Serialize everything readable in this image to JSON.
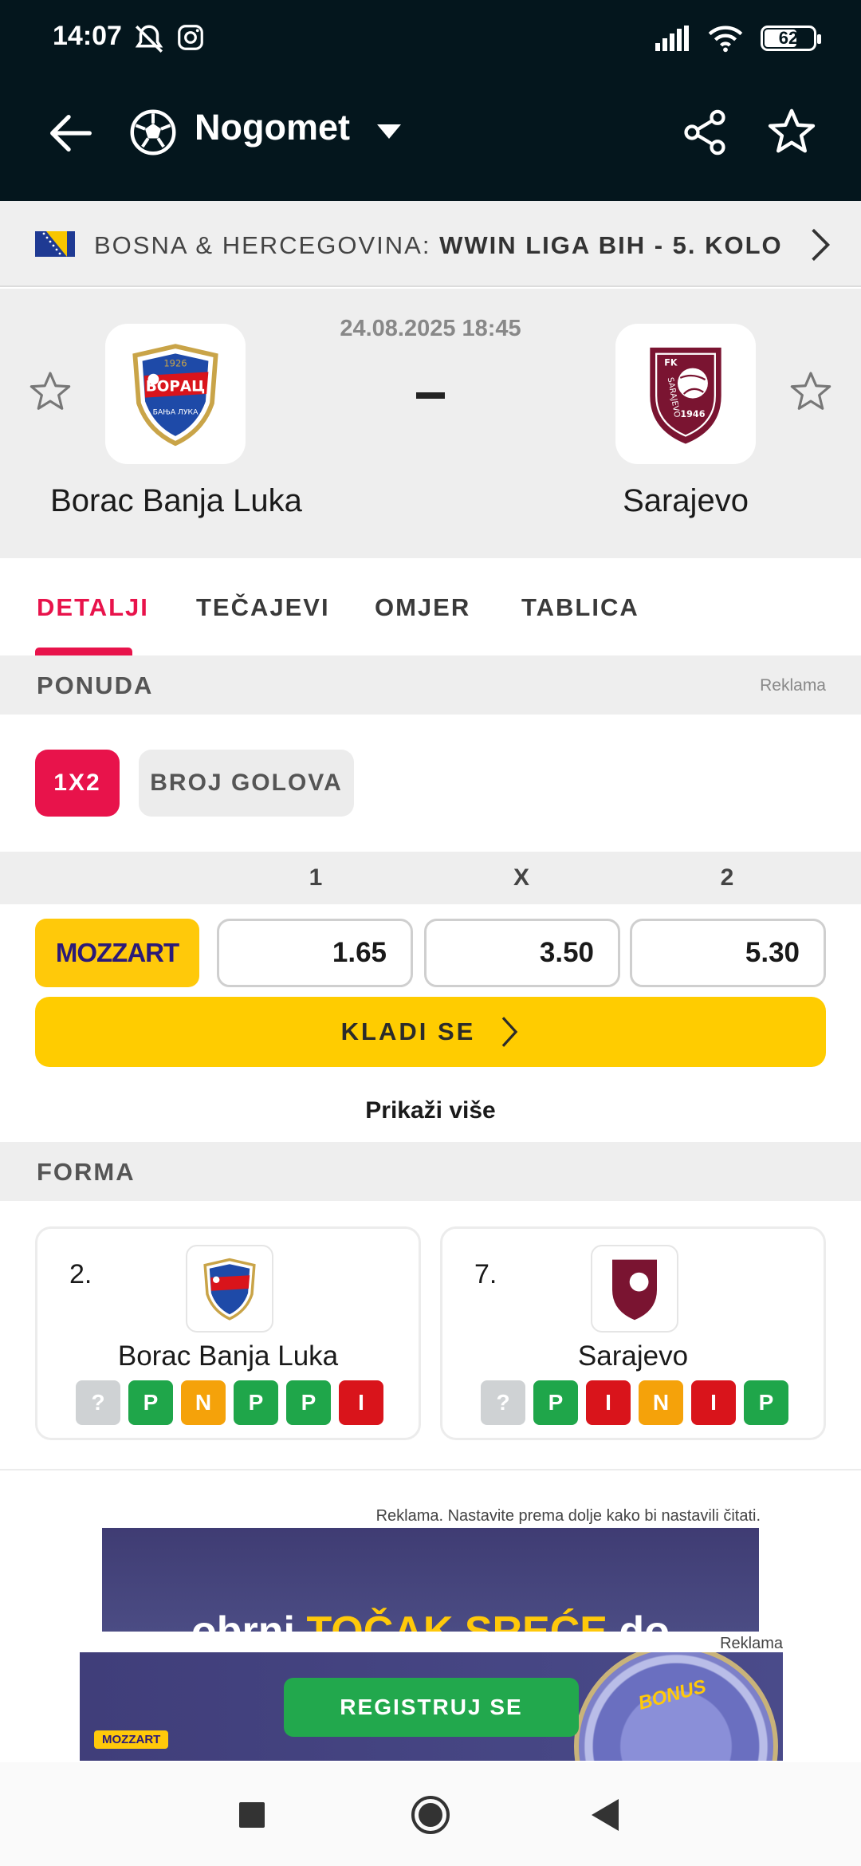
{
  "status_bar": {
    "time": "14:07",
    "battery": "62",
    "icons": [
      "bell-off-icon",
      "instagram-icon",
      "signal-icon",
      "wifi-icon",
      "battery-icon"
    ]
  },
  "app_bar": {
    "sport": "Nogomet"
  },
  "league": {
    "country": "BOSNA & HERCEGOVINA:",
    "competition": "WWIN LIGA BIH - 5. KOLO"
  },
  "match": {
    "datetime": "24.08.2025 18:45",
    "score": "-",
    "home_team": "Borac Banja Luka",
    "away_team": "Sarajevo",
    "home_logo_year": "1926",
    "home_logo_name": "БОРАЦ",
    "home_logo_city": "БАЊА ЛУКА",
    "away_logo_fk": "FK",
    "away_logo_name": "SARAJEVO",
    "away_logo_year": "1946"
  },
  "tabs": [
    {
      "label": "DETALJI",
      "active": true
    },
    {
      "label": "TEČAJEVI",
      "active": false
    },
    {
      "label": "OMJER",
      "active": false
    },
    {
      "label": "TABLICA",
      "active": false
    }
  ],
  "offer": {
    "title": "PONUDA",
    "ad_label": "Reklama",
    "chips": [
      "1X2",
      "BROJ GOLOVA"
    ],
    "columns": [
      "1",
      "X",
      "2"
    ],
    "bookmaker": "MOZZART",
    "odds": [
      "1.65",
      "3.50",
      "5.30"
    ],
    "bet_button": "KLADI SE",
    "show_more": "Prikaži više"
  },
  "form": {
    "title": "FORMA",
    "home": {
      "rank": "2.",
      "name": "Borac Banja Luka",
      "results": [
        "?",
        "P",
        "N",
        "P",
        "P",
        "I"
      ]
    },
    "away": {
      "rank": "7.",
      "name": "Sarajevo",
      "results": [
        "?",
        "P",
        "I",
        "N",
        "I",
        "P"
      ]
    }
  },
  "ads": {
    "note": "Reklama. Nastavite prema dolje kako bi nastavili čitati.",
    "banner_text_a": "obrni ",
    "banner_text_b": "TOČAK SREĆE",
    "banner_text_c": " do",
    "label2": "Reklama",
    "register": "REGISTRUJ SE",
    "brand": "MOZZART",
    "wheel_text": "BONUS"
  },
  "colors": {
    "header_bg": "#04161d",
    "accent": "#e8134b",
    "mozzart_yellow": "#ffcc00",
    "win": "#1fa64a",
    "draw": "#f5a20a",
    "loss": "#d9141b"
  }
}
